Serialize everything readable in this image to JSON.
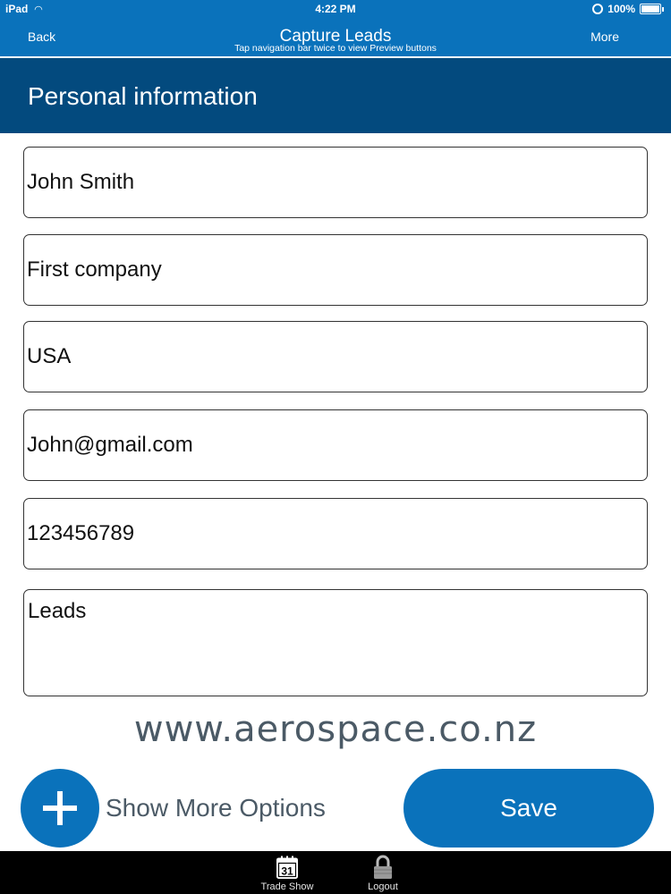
{
  "status_bar": {
    "device": "iPad",
    "time": "4:22 PM",
    "battery": "100%"
  },
  "nav": {
    "back_label": "Back",
    "title": "Capture Leads",
    "hint": "Tap navigation bar twice to view Preview buttons",
    "more_label": "More"
  },
  "section": {
    "title": "Personal information"
  },
  "fields": {
    "name": "John Smith",
    "company": "First company",
    "country": "USA",
    "email": "John@gmail.com",
    "phone": "123456789",
    "notes": "Leads"
  },
  "footer": {
    "website": "www.aerospace.co.nz",
    "show_more_label": "Show More Options",
    "save_label": "Save"
  },
  "tabbar": {
    "items": [
      {
        "label": "Trade Show",
        "icon": "calendar-icon",
        "icon_text": "31"
      },
      {
        "label": "Logout",
        "icon": "lock-icon"
      }
    ]
  },
  "colors": {
    "nav_blue": "#0a72bb",
    "header_navy": "#034a7e",
    "text_gray": "#4b5a66"
  }
}
